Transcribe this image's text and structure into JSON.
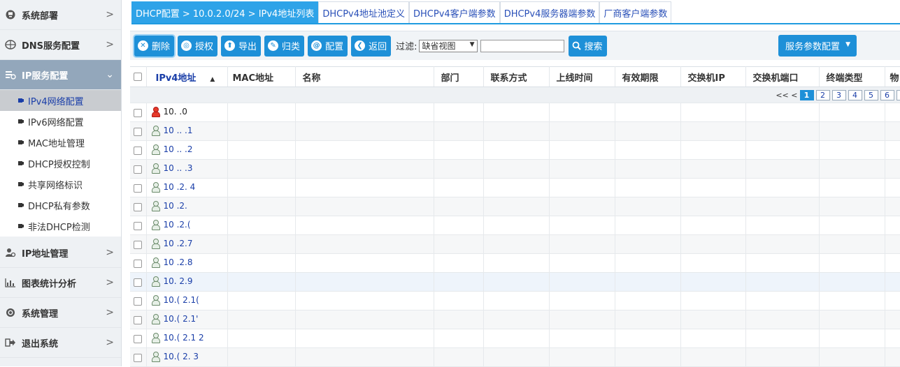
{
  "sidebar": {
    "groups": [
      {
        "label": "系统部署",
        "icon": "server-icon"
      },
      {
        "label": "DNS服务配置",
        "icon": "dns-icon"
      },
      {
        "label": "IP服务配置",
        "icon": "ip-service-icon",
        "expanded": true
      },
      {
        "label": "IP地址管理",
        "icon": "user-gear-icon"
      },
      {
        "label": "图表统计分析",
        "icon": "bar-chart-icon"
      },
      {
        "label": "系统管理",
        "icon": "gear-icon"
      },
      {
        "label": "退出系统",
        "icon": "logout-icon"
      }
    ],
    "sub_items": [
      "IPv4网络配置",
      "IPv6网络配置",
      "MAC地址管理",
      "DHCP授权控制",
      "共享网络标识",
      "DHCP私有参数",
      "非法DHCP检测"
    ],
    "active_sub_item": "IPv4网络配置"
  },
  "tabs": [
    {
      "label": "DHCP配置 > 10.0.2.0/24 > IPv4地址列表",
      "active": true
    },
    {
      "label": "DHCPv4地址池定义"
    },
    {
      "label": "DHCPv4客户端参数"
    },
    {
      "label": "DHCPv4服务器端参数"
    },
    {
      "label": "厂商客户端参数"
    }
  ],
  "toolbar": {
    "buttons": [
      {
        "label": "删除",
        "icon": "delete-icon"
      },
      {
        "label": "授权",
        "icon": "authorize-icon"
      },
      {
        "label": "导出",
        "icon": "export-icon"
      },
      {
        "label": "归类",
        "icon": "classify-icon"
      },
      {
        "label": "配置",
        "icon": "config-icon"
      },
      {
        "label": "返回",
        "icon": "back-icon"
      }
    ],
    "filter_label": "过滤:",
    "filter_value": "缺省视图",
    "search_value": "",
    "search_label": "搜索",
    "service_button": "服务参数配置"
  },
  "table": {
    "columns": [
      "IPv4地址",
      "MAC地址",
      "名称",
      "部门",
      "联系方式",
      "上线时间",
      "有效期限",
      "交换机IP",
      "交换机端口",
      "终端类型",
      "物"
    ],
    "pager": {
      "prev": "<< <",
      "pages": [
        "1",
        "2",
        "3",
        "4",
        "5",
        "6"
      ],
      "current": "1"
    },
    "rows": [
      {
        "ip": "10.  .0",
        "status": "red"
      },
      {
        "ip": "10 .. .1",
        "status": "normal"
      },
      {
        "ip": "10 .. .2",
        "status": "normal"
      },
      {
        "ip": "10 .. .3",
        "status": "normal"
      },
      {
        "ip": "10 .2. 4",
        "status": "normal"
      },
      {
        "ip": "10 .2. ",
        "status": "normal"
      },
      {
        "ip": "10 .2.(",
        "status": "normal"
      },
      {
        "ip": "10 .2.7",
        "status": "normal"
      },
      {
        "ip": "10 .2.8",
        "status": "normal"
      },
      {
        "ip": "10.  2.9",
        "status": "normal"
      },
      {
        "ip": "10.(  2.1(",
        "status": "normal"
      },
      {
        "ip": "10.(  2.1'",
        "status": "normal"
      },
      {
        "ip": "10.(  2.1 2",
        "status": "normal"
      },
      {
        "ip": "10.(  2. 3",
        "status": "normal"
      }
    ]
  }
}
